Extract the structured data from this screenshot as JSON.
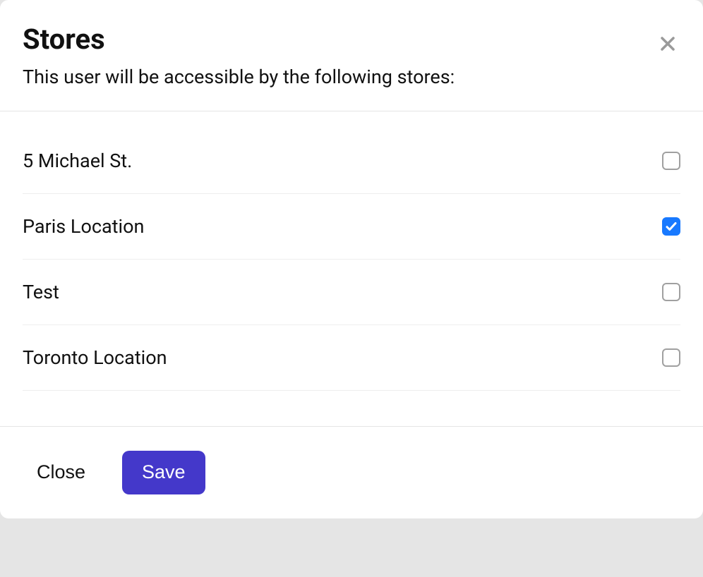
{
  "modal": {
    "title": "Stores",
    "subtitle": "This user will be accessible by the following stores:",
    "stores": [
      {
        "name": "5 Michael St.",
        "checked": false
      },
      {
        "name": "Paris Location",
        "checked": true
      },
      {
        "name": "Test",
        "checked": false
      },
      {
        "name": "Toronto Location",
        "checked": false
      }
    ],
    "buttons": {
      "close": "Close",
      "save": "Save"
    }
  }
}
